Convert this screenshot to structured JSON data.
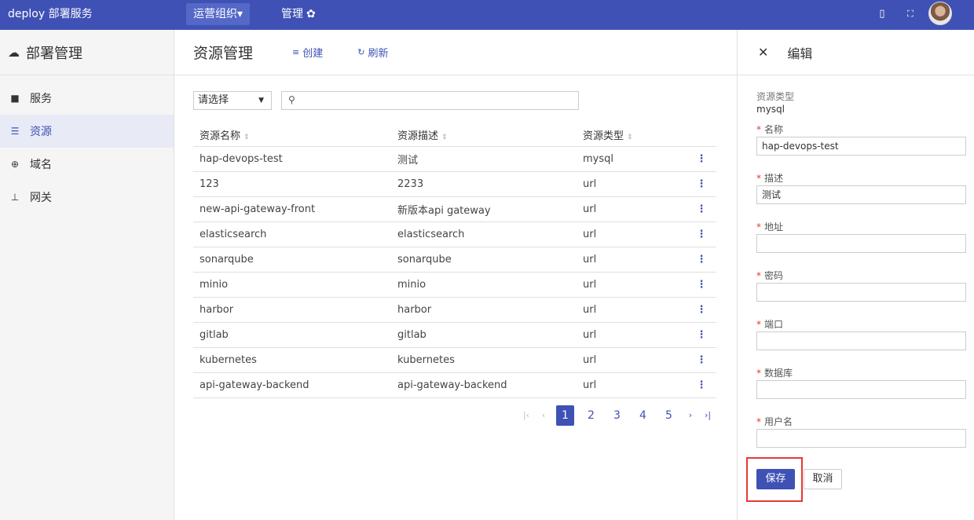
{
  "topbar": {
    "brand": "deploy 部署服务",
    "org_button": "运营组织▾",
    "manage": "管理"
  },
  "sidebar": {
    "title": "部署管理",
    "items": [
      {
        "label": "服务",
        "icon": "briefcase-icon"
      },
      {
        "label": "资源",
        "icon": "database-icon"
      },
      {
        "label": "域名",
        "icon": "globe-icon"
      },
      {
        "label": "网关",
        "icon": "gateway-icon"
      }
    ]
  },
  "main": {
    "title": "资源管理",
    "create_label": "创建",
    "refresh_label": "刷新",
    "filter_placeholder": "请选择",
    "columns": [
      "资源名称",
      "资源描述",
      "资源类型"
    ],
    "rows": [
      {
        "name": "hap-devops-test",
        "desc": "测试",
        "type": "mysql"
      },
      {
        "name": "123",
        "desc": "2233",
        "type": "url"
      },
      {
        "name": "new-api-gateway-front",
        "desc": "新版本api gateway",
        "type": "url"
      },
      {
        "name": "elasticsearch",
        "desc": "elasticsearch",
        "type": "url"
      },
      {
        "name": "sonarqube",
        "desc": "sonarqube",
        "type": "url"
      },
      {
        "name": "minio",
        "desc": "minio",
        "type": "url"
      },
      {
        "name": "harbor",
        "desc": "harbor",
        "type": "url"
      },
      {
        "name": "gitlab",
        "desc": "gitlab",
        "type": "url"
      },
      {
        "name": "kubernetes",
        "desc": "kubernetes",
        "type": "url"
      },
      {
        "name": "api-gateway-backend",
        "desc": "api-gateway-backend",
        "type": "url"
      }
    ],
    "pager": {
      "pages": [
        "1",
        "2",
        "3",
        "4",
        "5"
      ],
      "current": "1"
    }
  },
  "panel": {
    "title": "编辑",
    "type_label": "资源类型",
    "type_value": "mysql",
    "fields": [
      {
        "label": "名称",
        "value": "hap-devops-test"
      },
      {
        "label": "描述",
        "value": "测试"
      },
      {
        "label": "地址",
        "value": ""
      },
      {
        "label": "密码",
        "value": ""
      },
      {
        "label": "端口",
        "value": ""
      },
      {
        "label": "数据库",
        "value": ""
      },
      {
        "label": "用户名",
        "value": ""
      }
    ],
    "save_label": "保存",
    "cancel_label": "取消"
  },
  "colors": {
    "primary": "#3f51b5",
    "required": "#e53935",
    "highlight_box": "#e53935"
  }
}
